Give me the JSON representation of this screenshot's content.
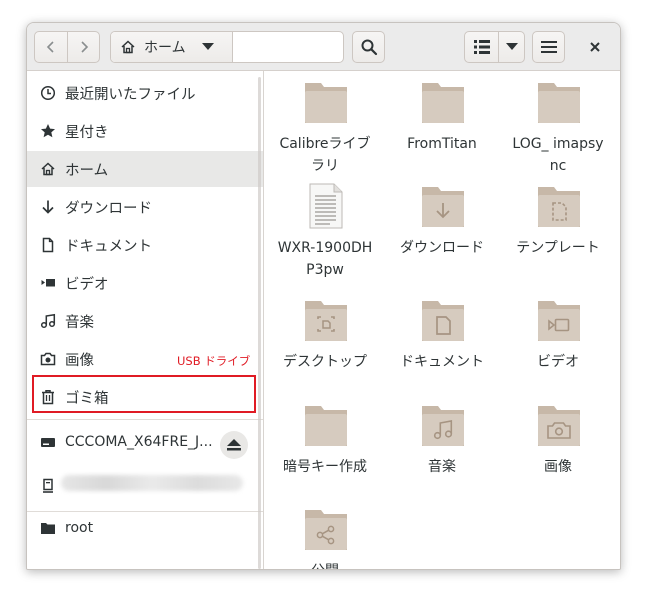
{
  "header": {
    "path_label": "ホーム"
  },
  "sidebar": {
    "items": [
      {
        "label": "最近開いたファイル",
        "icon": "clock-icon"
      },
      {
        "label": "星付き",
        "icon": "star-icon"
      },
      {
        "label": "ホーム",
        "icon": "home-icon"
      },
      {
        "label": "ダウンロード",
        "icon": "download-arrow-icon"
      },
      {
        "label": "ドキュメント",
        "icon": "document-icon"
      },
      {
        "label": "ビデオ",
        "icon": "video-icon"
      },
      {
        "label": "音楽",
        "icon": "music-note-icon"
      },
      {
        "label": "画像",
        "icon": "camera-icon"
      },
      {
        "label": "ゴミ箱",
        "icon": "trash-icon"
      }
    ],
    "annotation": "USB ドライブ",
    "usb_drive": "CCCOMA_X64FRE_J...",
    "other": "root"
  },
  "files": [
    {
      "name": "Calibreライブラリ",
      "icon": "folder-icon"
    },
    {
      "name": "FromTitan",
      "icon": "folder-icon"
    },
    {
      "name": "LOG_ imapsync",
      "icon": "folder-icon"
    },
    {
      "name": "WXR-1900DHP3pw",
      "icon": "text-file-icon"
    },
    {
      "name": "ダウンロード",
      "icon": "folder-download-icon"
    },
    {
      "name": "テンプレート",
      "icon": "folder-templates-icon"
    },
    {
      "name": "デスクトップ",
      "icon": "folder-desktop-icon"
    },
    {
      "name": "ドキュメント",
      "icon": "folder-documents-icon"
    },
    {
      "name": "ビデオ",
      "icon": "folder-videos-icon"
    },
    {
      "name": "暗号キー作成",
      "icon": "folder-icon"
    },
    {
      "name": "音楽",
      "icon": "folder-music-icon"
    },
    {
      "name": "画像",
      "icon": "folder-pictures-icon"
    },
    {
      "name": "公開",
      "icon": "folder-publicshare-icon"
    }
  ],
  "colors": {
    "accent_annotation": "#e01b24",
    "folder": "#d6cbbf",
    "folder_tab": "#c7b8a8",
    "text": "#2e3436"
  }
}
